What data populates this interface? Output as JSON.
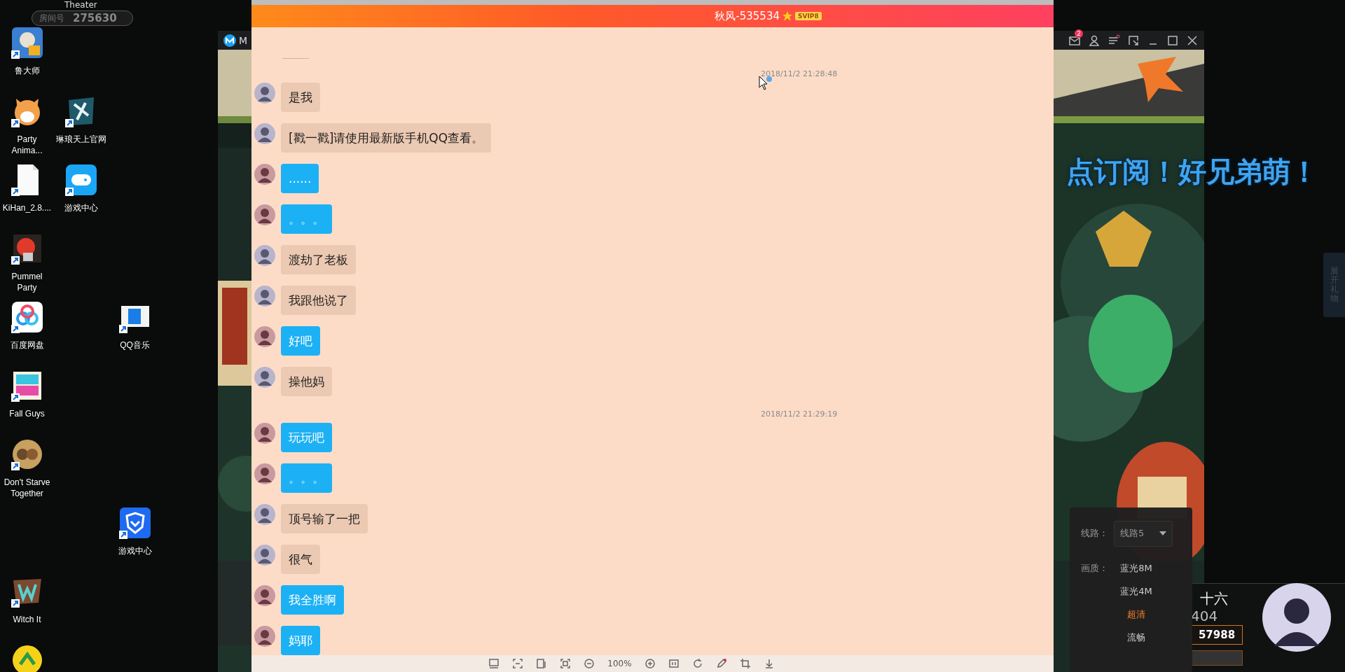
{
  "overlay": {
    "caption": "Theater",
    "room_label": "房间号",
    "room_number": "275630"
  },
  "desktop_icons": [
    {
      "label": "鲁大师"
    },
    {
      "label": "Party Anima..."
    },
    {
      "label": "琳琅天上官网"
    },
    {
      "label": "KiHan_2.8...."
    },
    {
      "label": "游戏中心"
    },
    {
      "label": "Pummel Party"
    },
    {
      "label": "百度网盘"
    },
    {
      "label": "QQ音乐"
    },
    {
      "label": "Fall Guys"
    },
    {
      "label": "Don't Starve Together"
    },
    {
      "label": "游戏中心"
    },
    {
      "label": "Witch It"
    }
  ],
  "stream_window": {
    "app_title": "M",
    "mail_badge": "2",
    "overlay_text": "点订阅！好兄弟萌！",
    "gift_tab": "展开礼物",
    "streamer": {
      "name": "十六",
      "number": "404",
      "score": "57988"
    },
    "quality_menu": {
      "line_label": "线路：",
      "line_value": "线路5",
      "quality_label": "画质：",
      "options": [
        {
          "label": "蓝光8M",
          "selected": false
        },
        {
          "label": "蓝光4M",
          "selected": false
        },
        {
          "label": "超清",
          "selected": true
        },
        {
          "label": "流畅",
          "selected": false
        }
      ]
    }
  },
  "chat_window": {
    "title": "秋风-535534",
    "badge": "SVIP8",
    "messages": [
      {
        "kind": "time",
        "text": "2018/11/2 21:28:48"
      },
      {
        "kind": "other",
        "text": "是我"
      },
      {
        "kind": "other",
        "text": "[戳一戳]请使用最新版手机QQ查看。"
      },
      {
        "kind": "self",
        "text": "......"
      },
      {
        "kind": "self",
        "text": "。。。"
      },
      {
        "kind": "other",
        "text": "渡劫了老板"
      },
      {
        "kind": "other",
        "text": "我跟他说了"
      },
      {
        "kind": "self",
        "text": "好吧"
      },
      {
        "kind": "other",
        "text": "操他妈"
      },
      {
        "kind": "time",
        "text": "2018/11/2 21:29:19"
      },
      {
        "kind": "self",
        "text": "玩玩吧"
      },
      {
        "kind": "self",
        "text": "。。。"
      },
      {
        "kind": "other",
        "text": "顶号输了一把"
      },
      {
        "kind": "other",
        "text": "很气"
      },
      {
        "kind": "self",
        "text": "我全胜啊"
      },
      {
        "kind": "self",
        "text": "妈耶"
      }
    ],
    "toolbar": {
      "zoom": "100%"
    }
  }
}
